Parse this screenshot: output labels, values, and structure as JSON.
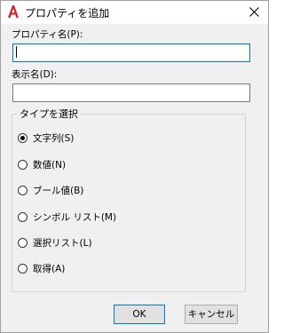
{
  "window": {
    "title": "プロパティを追加",
    "close_icon": "close-icon",
    "app_icon": "autocad-a-icon",
    "accent_color": "#0078d7"
  },
  "fields": {
    "property_name": {
      "label": "プロパティ名(P):",
      "value": ""
    },
    "display_name": {
      "label": "表示名(D):",
      "value": ""
    }
  },
  "type_group": {
    "title": "タイプを選択",
    "options": [
      {
        "label": "文字列(S)",
        "selected": true
      },
      {
        "label": "数値(N)",
        "selected": false
      },
      {
        "label": "ブール値(B)",
        "selected": false
      },
      {
        "label": "シンボル リスト(M)",
        "selected": false
      },
      {
        "label": "選択リスト(L)",
        "selected": false
      },
      {
        "label": "取得(A)",
        "selected": false
      }
    ]
  },
  "buttons": {
    "ok": "OK",
    "cancel": "キャンセル"
  }
}
